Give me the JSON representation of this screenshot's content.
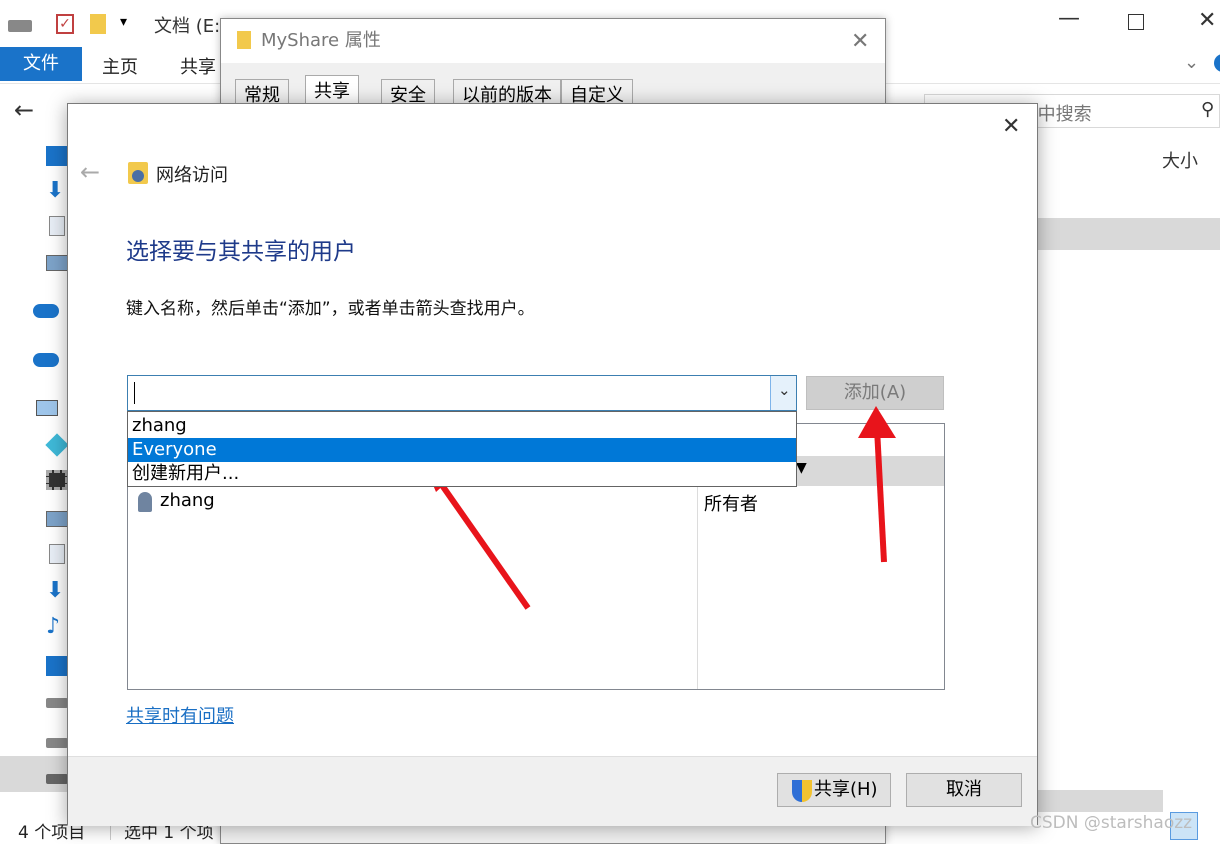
{
  "explorer": {
    "title": "文档 (E:)",
    "ribbon_tabs": [
      "文件",
      "主页",
      "共享"
    ],
    "search_placeholder": "在 文档 (E:) 中搜索",
    "column_size": "大小",
    "status_items": "4 个项目",
    "status_selected": "选中 1 个项"
  },
  "props": {
    "title": "MyShare 属性",
    "tabs": [
      "常规",
      "共享",
      "安全",
      "以前的版本",
      "自定义"
    ]
  },
  "dialog": {
    "breadcrumb": "网络访问",
    "heading": "选择要与其共享的用户",
    "instruction": "键入名称，然后单击“添加”，或者单击箭头查找用户。",
    "input_value": "",
    "add_button": "添加(A)",
    "dropdown_options": [
      "zhang",
      "Everyone",
      "创建新用户..."
    ],
    "selected_option": "Everyone",
    "list_rows": [
      {
        "name": "zhang",
        "level": "所有者"
      }
    ],
    "help_link": "共享时有问题",
    "share_button": "共享(H)",
    "cancel_button": "取消"
  },
  "watermark": "CSDN @starshaozz",
  "colors": {
    "accent": "#1a73c9",
    "heading": "#1e3a8a",
    "highlight": "#0078d7",
    "arrow": "#e8141b"
  }
}
